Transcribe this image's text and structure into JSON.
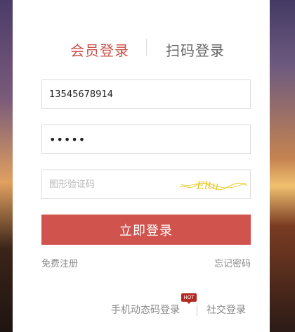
{
  "tabs": {
    "member_login": "会员登录",
    "scan_login": "扫码登录"
  },
  "form": {
    "phone_value": "13545678914",
    "password_value": "•••••",
    "captcha_placeholder": "图形验证码",
    "captcha_text": "Eltu"
  },
  "actions": {
    "login_button": "立即登录",
    "register_link": "免费注册",
    "forgot_link": "忘记密码",
    "sms_login_link": "手机动态码登录",
    "hot_badge": "HOT",
    "social_login_link": "社交登录"
  },
  "colors": {
    "accent": "#d0534e",
    "tab_active": "#c9514b",
    "captcha_ink": "#e8c820"
  }
}
